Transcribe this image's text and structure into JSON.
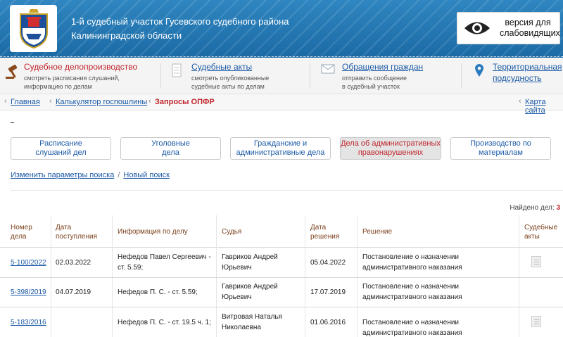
{
  "header": {
    "title_line1": "1-й судебный участок Гусевского судебного района",
    "title_line2": "Калининградской области",
    "vision_line1": "версия для",
    "vision_line2": "слабовидящих"
  },
  "nav": [
    {
      "label": "Судебное делопроизводство",
      "sub1": "смотреть расписания слушаний,",
      "sub2": "информацию по делам"
    },
    {
      "label": "Судебные акты",
      "sub1": "смотреть опубликованные",
      "sub2": "судебные акты по делам"
    },
    {
      "label": "Обращения граждан",
      "sub1": "отправить сообщение",
      "sub2": "в судебный участок"
    },
    {
      "label": "Территориальная",
      "sub1": "подсудность",
      "sub2": ""
    }
  ],
  "breadcrumb": {
    "home": "Главная",
    "calc": "Калькулятор госпошлины",
    "current": "Запросы ОПФР",
    "sitemap": "Карта сайта"
  },
  "dash_text": "_",
  "tabs": [
    {
      "line1": "Расписание",
      "line2": "слушаний дел"
    },
    {
      "line1": "Уголовные",
      "line2": "дела"
    },
    {
      "line1": "Гражданские и",
      "line2": "административные дела"
    },
    {
      "line1": "Дела об административных",
      "line2": "правонарушениях"
    },
    {
      "line1": "Производство по",
      "line2": "материалам"
    }
  ],
  "search": {
    "change": "Изменить параметры поиска",
    "separator": "/",
    "new": "Новый поиск"
  },
  "found": {
    "label": "Найдено дел:",
    "count": "3"
  },
  "columns": {
    "number": [
      "Номер",
      "дела"
    ],
    "received": [
      "Дата",
      "поступления"
    ],
    "info": "Информация по делу",
    "judge": "Судья",
    "decision_date": [
      "Дата",
      "решения"
    ],
    "decision": "Решение",
    "acts": [
      "Судебные",
      "акты"
    ]
  },
  "rows": [
    {
      "number": "5-100/2022",
      "received": "02.03.2022",
      "info1": "Нефедов Павел Сергеевич -",
      "info2": "ст. 5.59;",
      "judge1": "Гавриков Андрей",
      "judge2": "Юрьевич",
      "date": "05.04.2022",
      "decision1": "Постановление о назначении",
      "decision2": "административного наказания",
      "has_act": true
    },
    {
      "number": "5-398/2019",
      "received": "04.07.2019",
      "info1": "Нефедов П. С. - ст. 5.59;",
      "info2": "",
      "judge1": "Гавриков Андрей",
      "judge2": "Юрьевич",
      "date": "17.07.2019",
      "decision1": "Постановление о назначении",
      "decision2": "административного наказания",
      "has_act": false
    },
    {
      "number": "5-183/2016",
      "received": "",
      "info1": "Нефедов П. С. - ст. 19.5 ч. 1;",
      "info2": "",
      "judge1": "Витровая Наталья",
      "judge2": "Николаевна",
      "date": "01.06.2016",
      "decision1": "Постановление о назначении",
      "decision2": "административного наказания",
      "has_act": true
    }
  ],
  "colors": {
    "accent_red": "#c0262d",
    "link_blue": "#1c5aa6",
    "header_blue": "#1b6aa5"
  }
}
